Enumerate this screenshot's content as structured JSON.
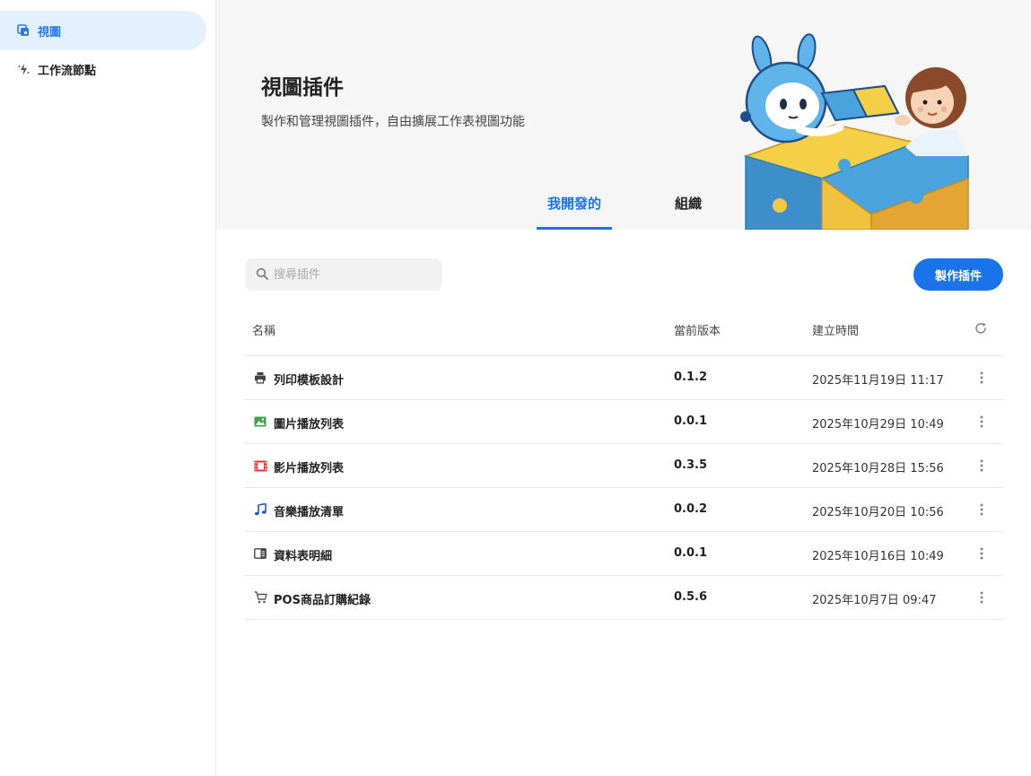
{
  "sidebar": {
    "items": [
      {
        "label": "視圖",
        "icon": "view-icon",
        "active": true
      },
      {
        "label": "工作流節點",
        "icon": "workflow-icon",
        "active": false
      }
    ]
  },
  "banner": {
    "title": "視圖插件",
    "subtitle": "製作和管理視圖插件，自由擴展工作表視圖功能",
    "tabs": [
      {
        "label": "我開發的",
        "active": true
      },
      {
        "label": "組織",
        "active": false
      }
    ]
  },
  "toolbar": {
    "search_placeholder": "搜尋插件",
    "create_label": "製作插件"
  },
  "table": {
    "headers": {
      "name": "名稱",
      "version": "當前版本",
      "created": "建立時間"
    },
    "rows": [
      {
        "icon": "printer-icon",
        "icon_color": "#444444",
        "name": "列印模板設計",
        "version": "0.1.2",
        "created": "2025年11月19日 11:17"
      },
      {
        "icon": "image-icon",
        "icon_color": "#43a047",
        "name": "圖片播放列表",
        "version": "0.0.1",
        "created": "2025年10月29日 10:49"
      },
      {
        "icon": "film-icon",
        "icon_color": "#e53935",
        "name": "影片播放列表",
        "version": "0.3.5",
        "created": "2025年10月28日 15:56"
      },
      {
        "icon": "music-note-icon",
        "icon_color": "#1e56c9",
        "name": "音樂播放清單",
        "version": "0.0.2",
        "created": "2025年10月20日 10:56"
      },
      {
        "icon": "detail-panel-icon",
        "icon_color": "#444444",
        "name": "資料表明細",
        "version": "0.0.1",
        "created": "2025年10月16日 10:49"
      },
      {
        "icon": "cart-icon",
        "icon_color": "#555555",
        "name": "POS商品訂購紀錄",
        "version": "0.5.6",
        "created": "2025年10月7日 09:47"
      }
    ]
  },
  "colors": {
    "accent": "#1a73e8",
    "active_nav_bg": "#e3f0fd"
  }
}
